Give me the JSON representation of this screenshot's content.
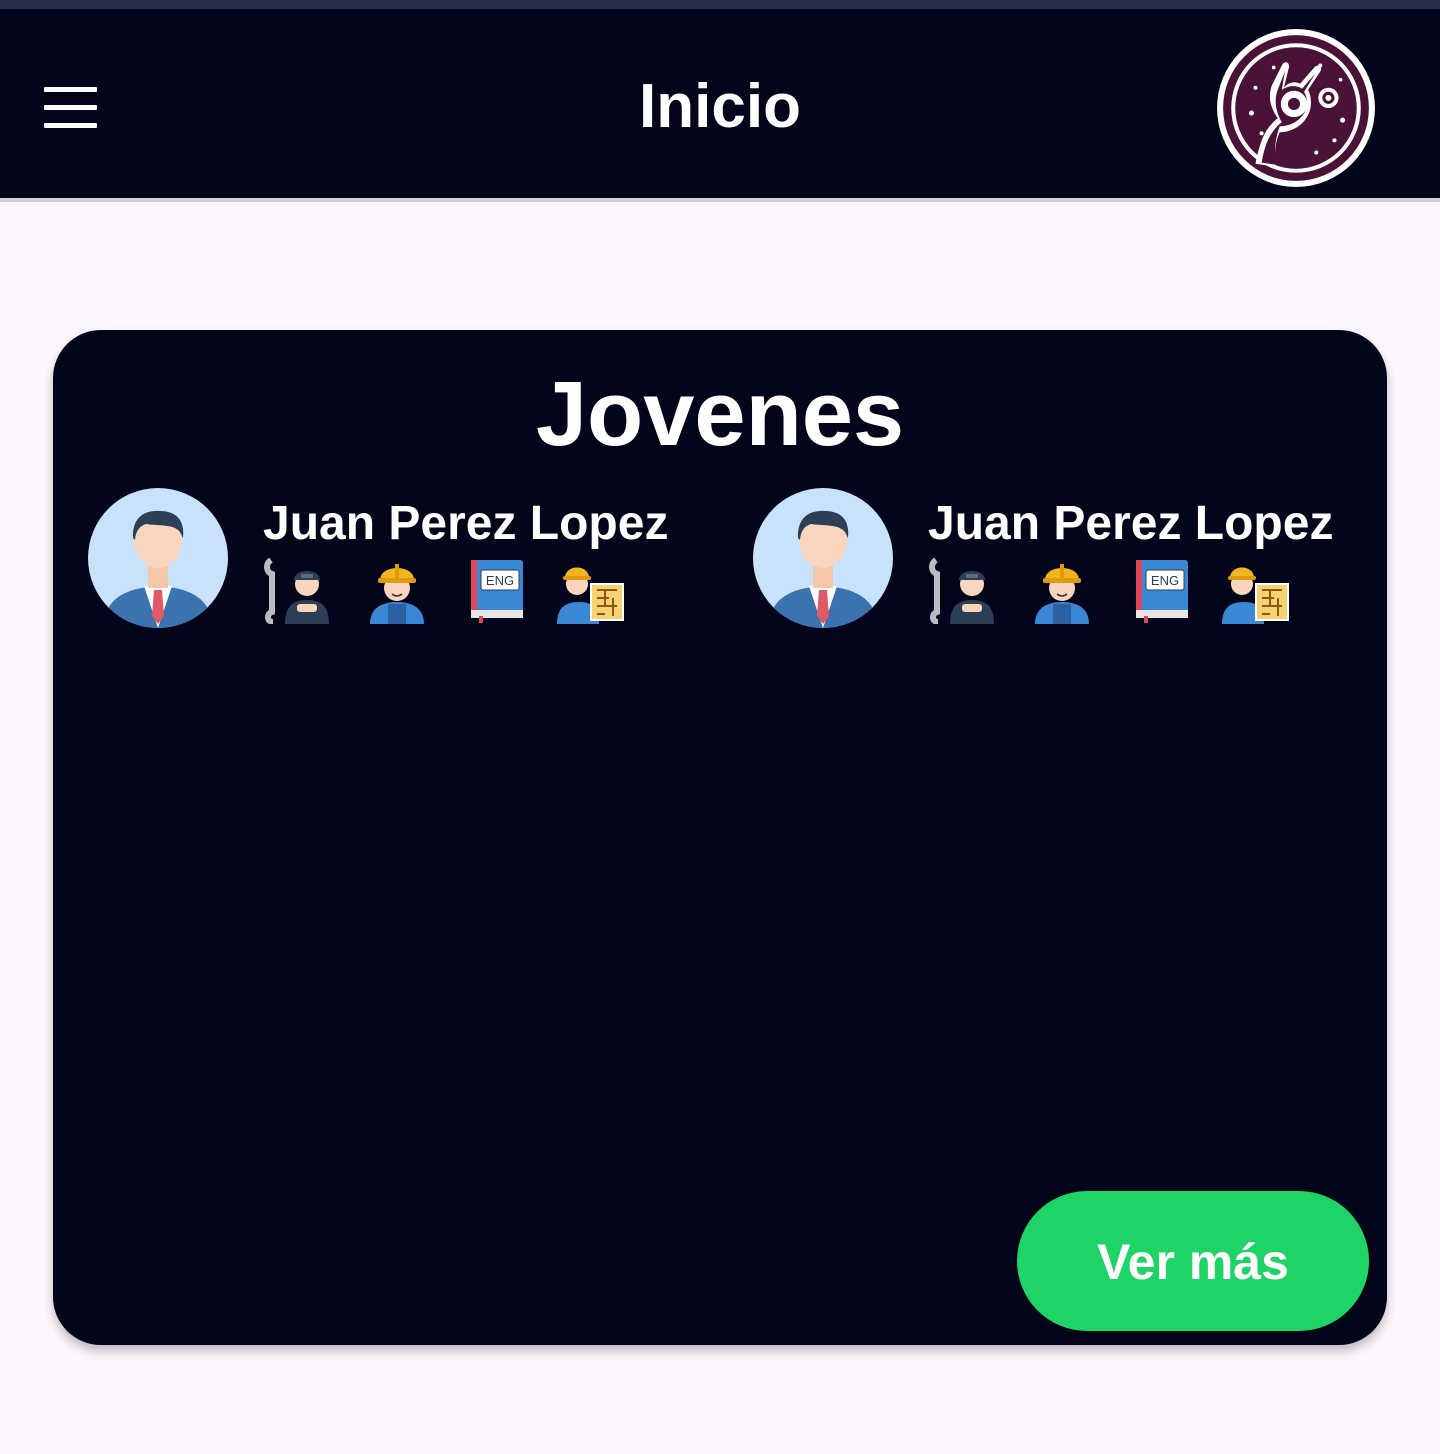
{
  "app_bar": {
    "title": "Inicio",
    "menu_icon": "menu-icon",
    "logo": "brand-logo"
  },
  "card": {
    "title": "Jovenes",
    "people": [
      {
        "name": "Juan Perez Lopez",
        "avatar": "businessman-avatar",
        "skills": [
          "mechanic-icon",
          "construction-worker-icon",
          "english-book-icon",
          "architect-icon"
        ]
      },
      {
        "name": "Juan Perez Lopez",
        "avatar": "businessman-avatar",
        "skills": [
          "mechanic-icon",
          "construction-worker-icon",
          "english-book-icon",
          "architect-icon"
        ]
      }
    ],
    "see_more_label": "Ver más"
  },
  "colors": {
    "app_bar_bg": "#03051a",
    "card_bg": "#03051a",
    "page_bg": "#fdf7fd",
    "button_bg": "#1fd466",
    "logo_purple": "#4a1236"
  }
}
